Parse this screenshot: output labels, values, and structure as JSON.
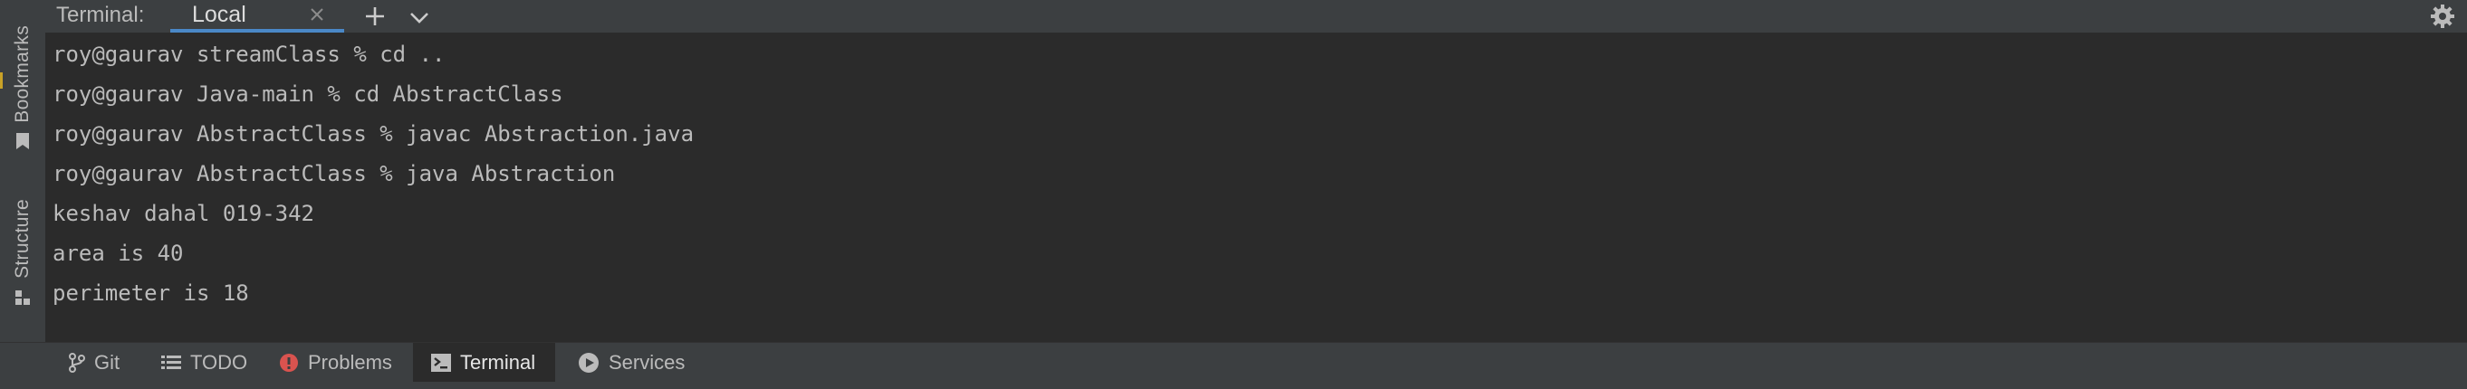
{
  "header": {
    "title": "Terminal:",
    "tabs": [
      {
        "label": "Local"
      }
    ]
  },
  "left_strip": {
    "bookmarks_label": "Bookmarks",
    "structure_label": "Structure"
  },
  "terminal": {
    "lines": [
      "roy@gaurav streamClass % cd ..",
      "roy@gaurav Java-main % cd AbstractClass",
      "roy@gaurav AbstractClass % javac Abstraction.java",
      "roy@gaurav AbstractClass % java Abstraction",
      "keshav dahal 019-342",
      "area is 40",
      "perimeter is 18"
    ]
  },
  "bottom_bar": {
    "items": [
      {
        "label": "Git",
        "icon": "git-branch-icon"
      },
      {
        "label": "TODO",
        "icon": "list-icon"
      },
      {
        "label": "Problems",
        "icon": "problems-icon"
      },
      {
        "label": "Terminal",
        "icon": "terminal-icon",
        "active": true
      },
      {
        "label": "Services",
        "icon": "services-icon"
      }
    ]
  },
  "colors": {
    "accent": "#4a88c7",
    "background": "#2b2b2b",
    "panel": "#3c3f41",
    "text": "#bbbbbb",
    "problems_icon": "#d9534f"
  }
}
